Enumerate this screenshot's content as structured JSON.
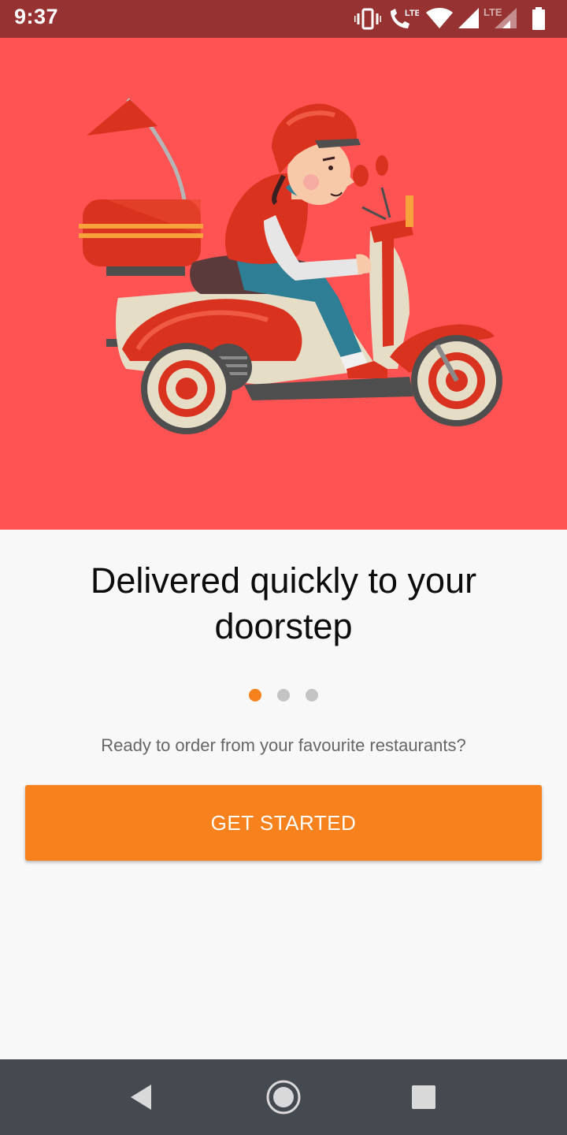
{
  "status_bar": {
    "time": "9:37",
    "icons": [
      "vibrate-icon",
      "lte-call-icon",
      "wifi-icon",
      "signal-icon",
      "lte-signal-icon",
      "battery-icon"
    ],
    "lte_label": "LTE",
    "background": "#963232"
  },
  "hero": {
    "background": "#ff5252",
    "illustration": "scooter-delivery-rider-illustration"
  },
  "onboarding": {
    "headline": "Delivered quickly to your doorstep",
    "subtitle": "Ready to order from your favourite restaurants?",
    "pager": {
      "count": 3,
      "active_index": 0,
      "active_color": "#f7811c",
      "inactive_color": "#c4c4c4"
    },
    "cta_label": "GET STARTED",
    "cta_color": "#f7811c"
  },
  "nav_bar": {
    "buttons": [
      "back-icon",
      "home-icon",
      "recents-icon"
    ],
    "background": "#454a50"
  }
}
